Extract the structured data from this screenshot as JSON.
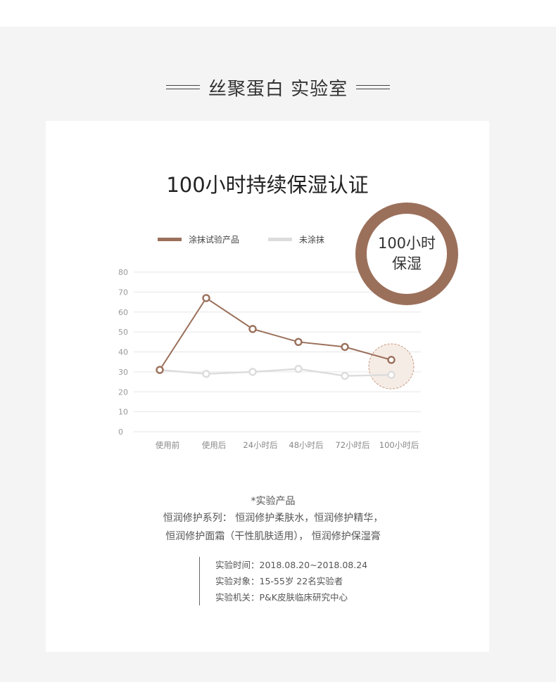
{
  "header": {
    "title": "丝聚蛋白 实验室"
  },
  "badge": {
    "line1": "100小时",
    "line2": "保湿"
  },
  "chart_data": {
    "type": "line",
    "title": "100小时持续保湿认证",
    "categories": [
      "使用前",
      "使用后",
      "24小时后",
      "48小时后",
      "72小时后",
      "100小时后"
    ],
    "series": [
      {
        "name": "涂抹试验产品",
        "values": [
          31,
          67,
          51.5,
          45,
          42.5,
          36
        ],
        "color": "#9b705b"
      },
      {
        "name": "未涂抹",
        "values": [
          31,
          29,
          30,
          31.5,
          28,
          28.5
        ],
        "color": "#dcdcdc"
      }
    ],
    "y_ticks": [
      "0",
      "10",
      "20",
      "30",
      "40",
      "50",
      "60",
      "70",
      "80"
    ],
    "ylim": [
      0,
      80
    ],
    "grid": true,
    "legend": "top-left",
    "highlight_category": "100小时后"
  },
  "notes": {
    "product_heading": "*实验产品",
    "line1": "恒润修护系列： 恒润修护柔肤水，恒润修护精华，",
    "line2": "恒润修护面霜（干性肌肤适用）， 恒润修护保湿膏"
  },
  "info": {
    "time": "实验时间：2018.08.20~2018.08.24",
    "subjects": "实验对象：15-55岁 22名实验者",
    "org": "实验机关：P&K皮肤临床研究中心"
  }
}
